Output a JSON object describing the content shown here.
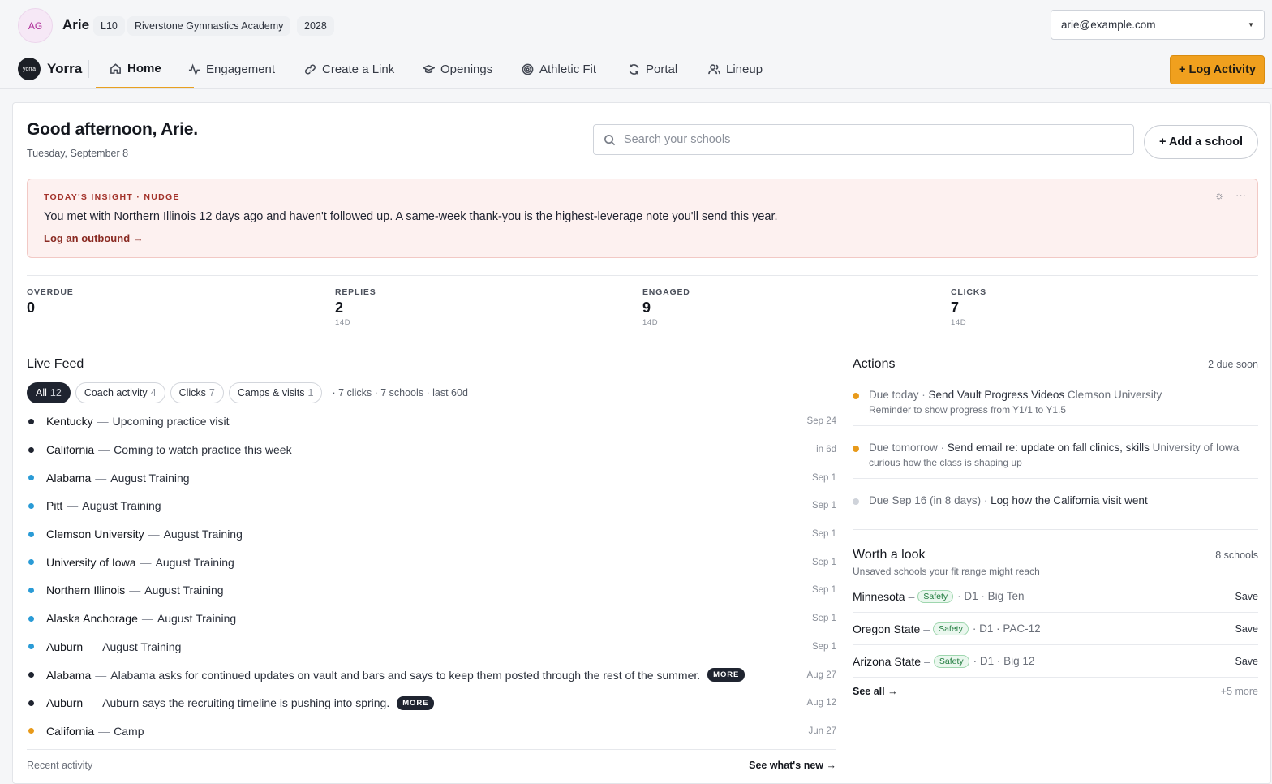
{
  "user": {
    "initials": "AG",
    "name": "Arie",
    "level": "L10",
    "academy": "Riverstone Gymnastics Academy",
    "class_year": "2028",
    "email": "arie@example.com"
  },
  "brand": {
    "logo_text": "yorra",
    "name": "Yorra"
  },
  "nav": {
    "items": [
      {
        "label": "Home",
        "icon": "home-icon",
        "active": true
      },
      {
        "label": "Engagement",
        "icon": "activity-icon"
      },
      {
        "label": "Create a Link",
        "icon": "link-icon"
      },
      {
        "label": "Openings",
        "icon": "graduation-cap-icon"
      },
      {
        "label": "Athletic Fit",
        "icon": "target-icon"
      },
      {
        "label": "Portal",
        "icon": "refresh-icon"
      },
      {
        "label": "Lineup",
        "icon": "users-icon"
      }
    ],
    "log_activity_label": "+ Log Activity"
  },
  "header": {
    "greeting": "Good afternoon, Arie.",
    "date": "Tuesday, September 8",
    "search_placeholder": "Search your schools",
    "add_school_label": "+ Add a school"
  },
  "insight": {
    "tag": "TODAY'S INSIGHT · NUDGE",
    "text": "You met with Northern Illinois 12 days ago and haven't followed up. A same-week thank-you is the highest-leverage note you'll send this year.",
    "link": "Log an outbound →"
  },
  "stats": [
    {
      "label": "OVERDUE",
      "value": "0",
      "sub": ""
    },
    {
      "label": "REPLIES",
      "value": "2",
      "sub": "14D"
    },
    {
      "label": "ENGAGED",
      "value": "9",
      "sub": "14D"
    },
    {
      "label": "CLICKS",
      "value": "7",
      "sub": "14D"
    }
  ],
  "feed": {
    "title": "Live Feed",
    "chips": [
      {
        "label": "All",
        "count": "12",
        "active": true
      },
      {
        "label": "Coach activity",
        "count": "4"
      },
      {
        "label": "Clicks",
        "count": "7"
      },
      {
        "label": "Camps & visits",
        "count": "1"
      }
    ],
    "summary": "· 7 clicks · 7 schools · last 60d",
    "colors": {
      "coach": "#1f2430",
      "click": "#2a9bd6",
      "camp": "#e89a1a"
    },
    "rows": [
      {
        "school": "Kentucky",
        "text": "Upcoming practice visit",
        "when": "Sep 24",
        "kind": "coach"
      },
      {
        "school": "California",
        "text": "Coming to watch practice this week",
        "when": "in 6d",
        "kind": "coach"
      },
      {
        "school": "Alabama",
        "text": "August Training",
        "when": "Sep 1",
        "kind": "click"
      },
      {
        "school": "Pitt",
        "text": "August Training",
        "when": "Sep 1",
        "kind": "click"
      },
      {
        "school": "Clemson University",
        "text": "August Training",
        "when": "Sep 1",
        "kind": "click"
      },
      {
        "school": "University of Iowa",
        "text": "August Training",
        "when": "Sep 1",
        "kind": "click"
      },
      {
        "school": "Northern Illinois",
        "text": "August Training",
        "when": "Sep 1",
        "kind": "click"
      },
      {
        "school": "Alaska Anchorage",
        "text": "August Training",
        "when": "Sep 1",
        "kind": "click"
      },
      {
        "school": "Auburn",
        "text": "August Training",
        "when": "Sep 1",
        "kind": "click"
      },
      {
        "school": "Alabama",
        "text": "Alabama asks for continued updates on vault and bars and says to keep them posted through the rest of the summer.",
        "when": "Aug 27",
        "kind": "coach",
        "more": "MORE"
      },
      {
        "school": "Auburn",
        "text": "Auburn says the recruiting timeline is pushing into spring.",
        "when": "Aug 12",
        "kind": "coach",
        "more": "MORE"
      },
      {
        "school": "California",
        "text": "Camp",
        "when": "Jun 27",
        "kind": "camp"
      }
    ],
    "footer_left": "Recent activity",
    "footer_right": "See what's new →"
  },
  "actions": {
    "title": "Actions",
    "meta": "2 due soon",
    "items": [
      {
        "due": "Due today",
        "task": "Send Vault Progress Videos",
        "org": "Clemson University",
        "note": "Reminder to show progress from Y1/1 to Y1.5",
        "color": "#e89a1a"
      },
      {
        "due": "Due tomorrow",
        "task": "Send email re: update on fall clinics, skills",
        "org": "University of Iowa",
        "note": "curious how the class is shaping up",
        "color": "#e89a1a"
      },
      {
        "due": "Due Sep 16 (in 8 days)",
        "task": "Log how the California visit went",
        "org": "",
        "note": "",
        "color": "#cfd3da"
      }
    ]
  },
  "worth": {
    "title": "Worth a look",
    "meta": "8 schools",
    "subtitle": "Unsaved schools your fit range might reach",
    "items": [
      {
        "name": "Minnesota",
        "tag": "Safety",
        "meta": "· D1 · Big Ten",
        "save": "Save"
      },
      {
        "name": "Oregon State",
        "tag": "Safety",
        "meta": "· D1 · PAC-12",
        "save": "Save"
      },
      {
        "name": "Arizona State",
        "tag": "Safety",
        "meta": "· D1 · Big 12",
        "save": "Save"
      }
    ],
    "see_all": "See all →",
    "more": "+5 more"
  }
}
